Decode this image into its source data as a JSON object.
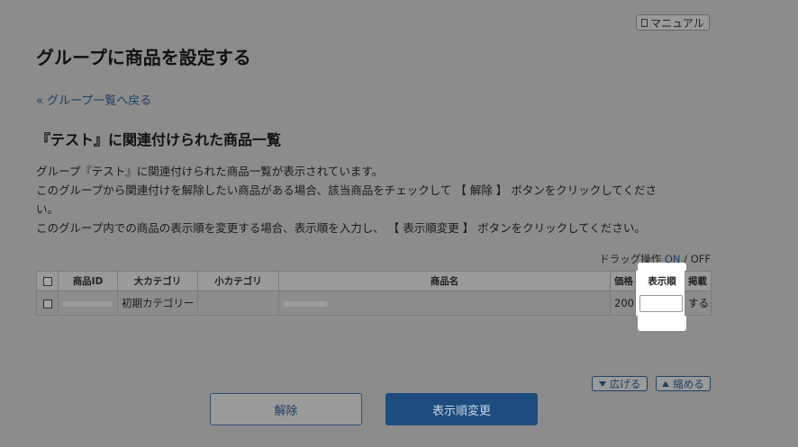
{
  "header": {
    "manual_label": "マニュアル",
    "title": "グループに商品を設定する",
    "back_link": "« グループ一覧へ戻る"
  },
  "section": {
    "title": "『テスト』に関連付けられた商品一覧",
    "desc_line1": "グループ『テスト』に関連付けられた商品一覧が表示されています。",
    "desc_line2": "このグループから関連付けを解除したい商品がある場合、該当商品をチェックして 【 解除 】 ボタンをクリックしてくださ",
    "desc_line2b": "い。",
    "desc_line3": "このグループ内での商品の表示順を変更する場合、表示順を入力し、 【 表示順変更 】 ボタンをクリックしてください。"
  },
  "drag_toggle": {
    "label": "ドラッグ操作",
    "on": "ON",
    "separator": " / ",
    "off": "OFF"
  },
  "table": {
    "headers": {
      "product_id": "商品ID",
      "main_category": "大カテゴリ",
      "sub_category": "小カテゴリ",
      "product_name": "商品名",
      "price": "価格",
      "display_order": "表示順",
      "published": "掲載"
    },
    "rows": [
      {
        "main_category": "初期カテゴリー",
        "sub_category": "",
        "price": "200",
        "display_order": "",
        "published": "する"
      }
    ]
  },
  "controls": {
    "expand_label": "広げる",
    "collapse_label": "縮める",
    "unlink_button": "解除",
    "order_button": "表示順変更"
  },
  "colors": {
    "overlay_bg": "#8c8c8c",
    "primary_button": "#1c4d7e",
    "link": "#1d3f66",
    "highlight": "#ffffff"
  }
}
